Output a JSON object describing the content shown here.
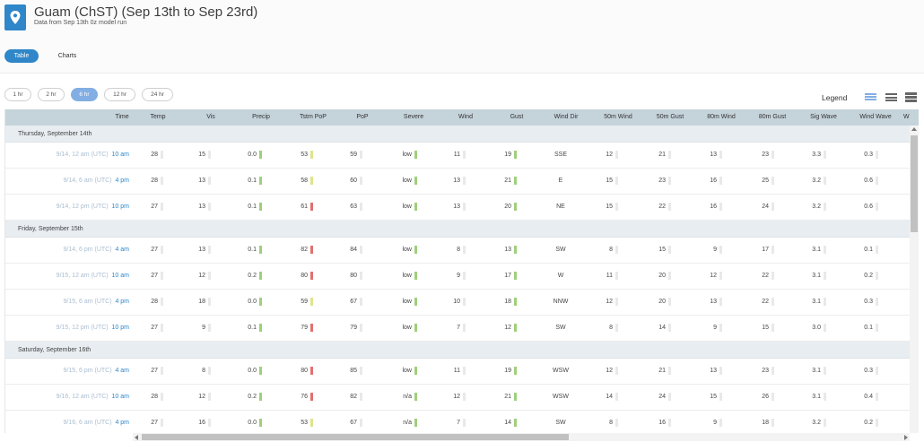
{
  "header": {
    "title": "Guam (ChST) (Sep 13th to Sep 23rd)",
    "subtitle": "Data from Sep 13th 0z model run",
    "icon": "map-pin-icon"
  },
  "view_tabs": [
    {
      "label": "Table",
      "active": true
    },
    {
      "label": "Charts",
      "active": false
    }
  ],
  "intervals": [
    {
      "label": "1 hr",
      "active": false
    },
    {
      "label": "2 hr",
      "active": false
    },
    {
      "label": "6 hr",
      "active": true
    },
    {
      "label": "12 hr",
      "active": false
    },
    {
      "label": "24 hr",
      "active": false
    }
  ],
  "legend_label": "Legend",
  "density_icons": [
    "compact-rows-icon",
    "normal-rows-icon",
    "large-rows-icon"
  ],
  "columns": [
    "Time",
    "Temp",
    "Vis",
    "Precip",
    "Tstm PoP",
    "PoP",
    "Severe",
    "Wind",
    "Gust",
    "Wind Dir",
    "50m Wind",
    "50m Gust",
    "80m Wind",
    "80m Gust",
    "Sig Wave",
    "Wind Wave",
    "W"
  ],
  "bar_colors": {
    "g": "#9fcf7b",
    "y": "#dde48c",
    "r": "#e46f6f",
    "n": "#e9e9e9"
  },
  "groups": [
    {
      "label": "Thursday, September 14th",
      "rows": [
        {
          "utc": "9/14, 12 am (UTC)",
          "local": "10 am",
          "temp": "28",
          "vis": "15",
          "precip": "0.0",
          "tstm_pop": "53",
          "tstm_c": "y",
          "pop": "59",
          "severe": "low",
          "wind": "11",
          "gust": "19",
          "wind_dir": "SSE",
          "wind50": "12",
          "gust50": "21",
          "wind80": "13",
          "gust80": "23",
          "sig_wave": "3.3",
          "wind_wave": "0.3"
        },
        {
          "utc": "9/14, 6 am (UTC)",
          "local": "4 pm",
          "temp": "28",
          "vis": "13",
          "precip": "0.1",
          "tstm_pop": "58",
          "tstm_c": "y",
          "pop": "60",
          "severe": "low",
          "wind": "13",
          "gust": "21",
          "wind_dir": "E",
          "wind50": "15",
          "gust50": "23",
          "wind80": "16",
          "gust80": "25",
          "sig_wave": "3.2",
          "wind_wave": "0.6"
        },
        {
          "utc": "9/14, 12 pm (UTC)",
          "local": "10 pm",
          "temp": "27",
          "vis": "13",
          "precip": "0.1",
          "tstm_pop": "61",
          "tstm_c": "r",
          "pop": "63",
          "severe": "low",
          "wind": "13",
          "gust": "20",
          "wind_dir": "NE",
          "wind50": "15",
          "gust50": "22",
          "wind80": "16",
          "gust80": "24",
          "sig_wave": "3.2",
          "wind_wave": "0.6"
        }
      ]
    },
    {
      "label": "Friday, September 15th",
      "rows": [
        {
          "utc": "9/14, 6 pm (UTC)",
          "local": "4 am",
          "temp": "27",
          "vis": "13",
          "precip": "0.1",
          "tstm_pop": "82",
          "tstm_c": "r",
          "pop": "84",
          "severe": "low",
          "wind": "8",
          "gust": "13",
          "wind_dir": "SW",
          "wind50": "8",
          "gust50": "15",
          "wind80": "9",
          "gust80": "17",
          "sig_wave": "3.1",
          "wind_wave": "0.1"
        },
        {
          "utc": "9/15, 12 am (UTC)",
          "local": "10 am",
          "temp": "27",
          "vis": "12",
          "precip": "0.2",
          "tstm_pop": "80",
          "tstm_c": "r",
          "pop": "80",
          "severe": "low",
          "wind": "9",
          "gust": "17",
          "wind_dir": "W",
          "wind50": "11",
          "gust50": "20",
          "wind80": "12",
          "gust80": "22",
          "sig_wave": "3.1",
          "wind_wave": "0.2"
        },
        {
          "utc": "9/15, 6 am (UTC)",
          "local": "4 pm",
          "temp": "28",
          "vis": "18",
          "precip": "0.0",
          "tstm_pop": "59",
          "tstm_c": "y",
          "pop": "67",
          "severe": "low",
          "wind": "10",
          "gust": "18",
          "wind_dir": "NNW",
          "wind50": "12",
          "gust50": "20",
          "wind80": "13",
          "gust80": "22",
          "sig_wave": "3.1",
          "wind_wave": "0.3"
        },
        {
          "utc": "9/15, 12 pm (UTC)",
          "local": "10 pm",
          "temp": "27",
          "vis": "9",
          "precip": "0.1",
          "tstm_pop": "79",
          "tstm_c": "r",
          "pop": "79",
          "severe": "low",
          "wind": "7",
          "gust": "12",
          "wind_dir": "SW",
          "wind50": "8",
          "gust50": "14",
          "wind80": "9",
          "gust80": "15",
          "sig_wave": "3.0",
          "wind_wave": "0.1"
        }
      ]
    },
    {
      "label": "Saturday, September 16th",
      "rows": [
        {
          "utc": "9/15, 6 pm (UTC)",
          "local": "4 am",
          "temp": "27",
          "vis": "8",
          "precip": "0.0",
          "tstm_pop": "80",
          "tstm_c": "r",
          "pop": "85",
          "severe": "low",
          "wind": "11",
          "gust": "19",
          "wind_dir": "WSW",
          "wind50": "12",
          "gust50": "21",
          "wind80": "13",
          "gust80": "23",
          "sig_wave": "3.1",
          "wind_wave": "0.3"
        },
        {
          "utc": "9/16, 12 am (UTC)",
          "local": "10 am",
          "temp": "28",
          "vis": "12",
          "precip": "0.2",
          "tstm_pop": "76",
          "tstm_c": "r",
          "pop": "82",
          "severe": "n/a",
          "wind": "12",
          "gust": "21",
          "wind_dir": "WSW",
          "wind50": "14",
          "gust50": "24",
          "wind80": "15",
          "gust80": "26",
          "sig_wave": "3.1",
          "wind_wave": "0.4"
        },
        {
          "utc": "9/16, 6 am (UTC)",
          "local": "4 pm",
          "temp": "27",
          "vis": "16",
          "precip": "0.0",
          "tstm_pop": "53",
          "tstm_c": "y",
          "pop": "67",
          "severe": "n/a",
          "wind": "7",
          "gust": "14",
          "wind_dir": "SW",
          "wind50": "8",
          "gust50": "16",
          "wind80": "9",
          "gust80": "18",
          "sig_wave": "3.2",
          "wind_wave": "0.2"
        }
      ]
    }
  ]
}
